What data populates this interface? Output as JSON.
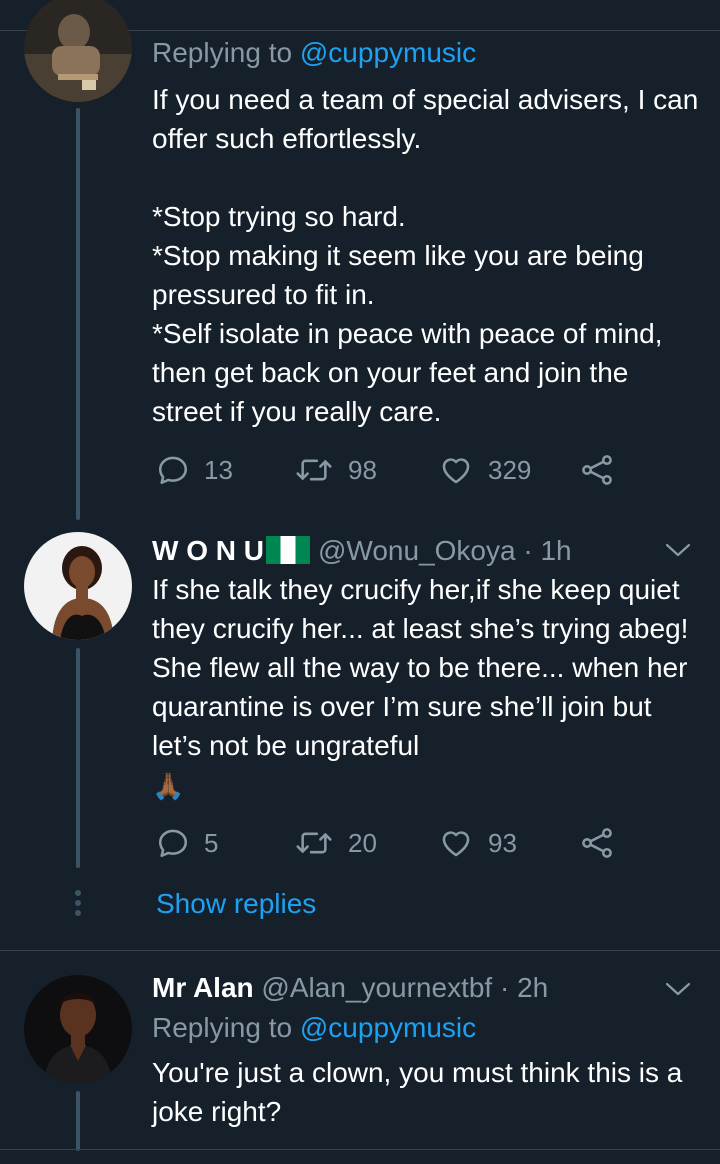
{
  "tweets": [
    {
      "replying_prefix": "Replying to ",
      "replying_handle": "@cuppymusic",
      "text": "If you need a team of special advisers, I can offer such effortlessly.\n\n*Stop trying so hard.\n*Stop making it seem like you are being pressured to fit in.\n*Self isolate in peace with peace of mind, then get back on your feet and join the street if you really care.",
      "replies": "13",
      "retweets": "98",
      "likes": "329"
    },
    {
      "name": "W O N U",
      "handle": "@Wonu_Okoya",
      "time": "· 1h",
      "flag": "Nigeria flag",
      "text": "If she talk they crucify her,if she keep quiet they crucify her... at least she’s trying abeg! She flew all the way to be there... when her quarantine is over I’m sure she’ll join but let’s not be ungrateful",
      "emoji": "🙏🏾",
      "replies": "5",
      "retweets": "20",
      "likes": "93",
      "show_replies": "Show replies"
    },
    {
      "name": "Mr Alan",
      "handle": "@Alan_yournextbf",
      "time": "· 2h",
      "replying_prefix": "Replying to ",
      "replying_handle": "@cuppymusic",
      "text": "You're just a clown, you must think this is a joke right?"
    }
  ],
  "icons": {
    "reply": "reply-icon",
    "retweet": "retweet-icon",
    "like": "heart-icon",
    "share": "share-icon",
    "menu": "chevron-down-icon"
  },
  "colors": {
    "background": "#15202b",
    "accent": "#1da1f2",
    "muted": "#8899a6",
    "divider": "#38444d"
  }
}
